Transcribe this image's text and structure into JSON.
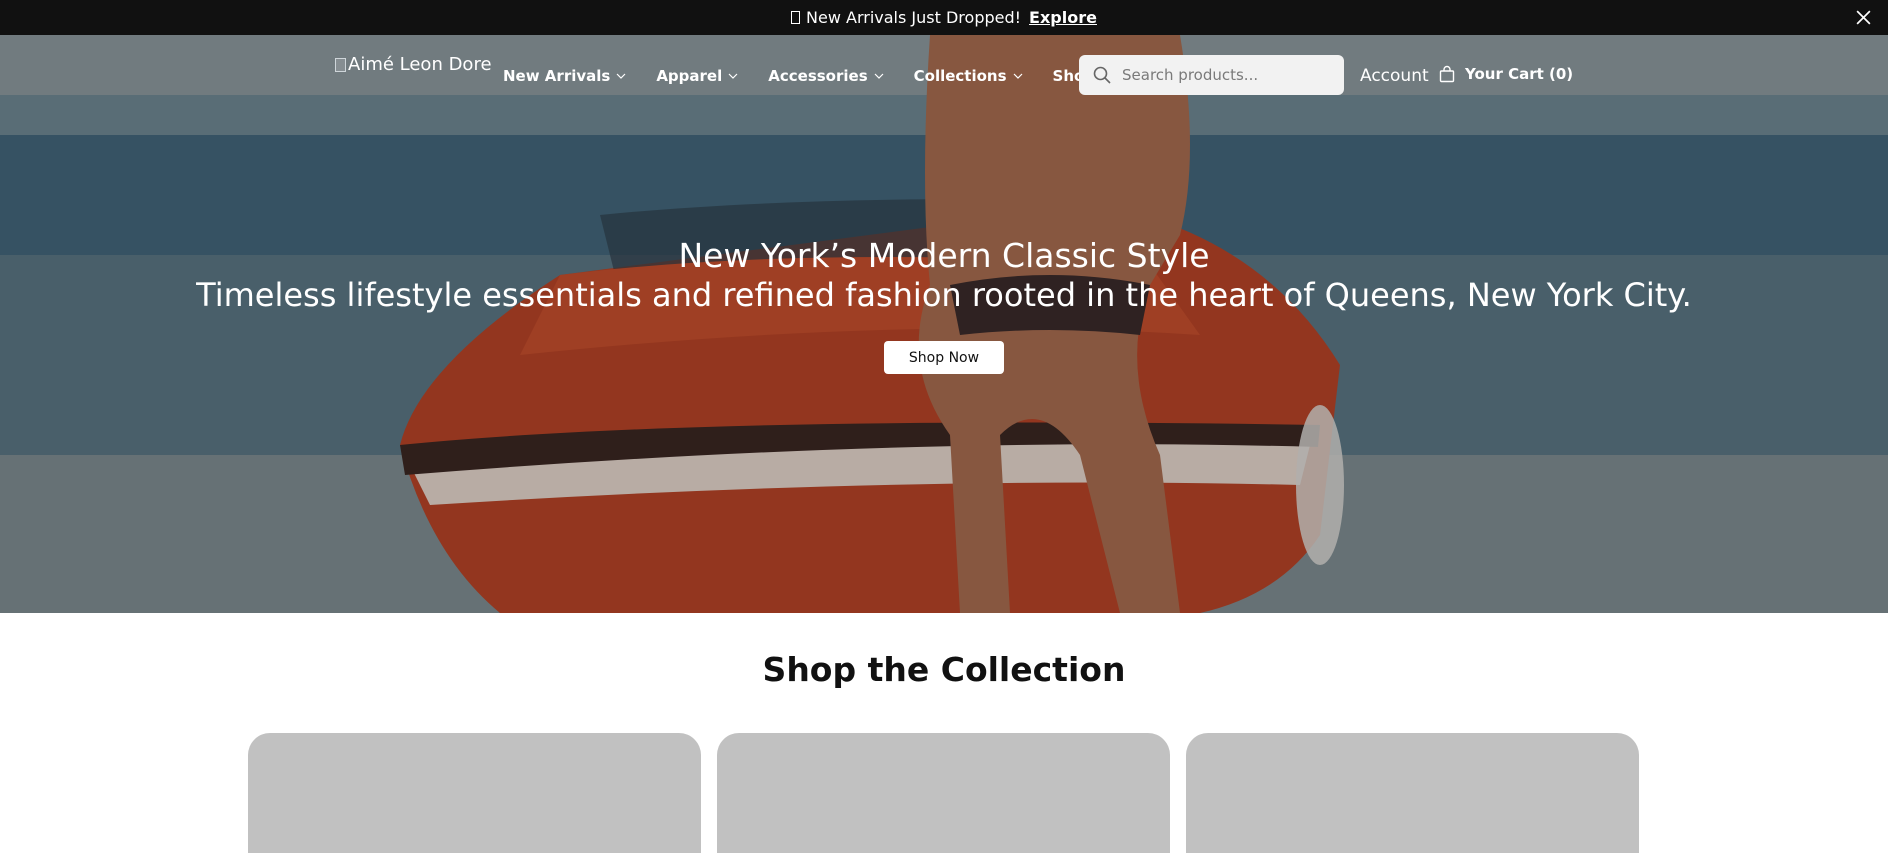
{
  "announcement": {
    "text": "New Arrivals Just Dropped!",
    "link_label": "Explore"
  },
  "header": {
    "logo_alt": "Aimé Leon Dore",
    "nav": [
      {
        "label": "New Arrivals"
      },
      {
        "label": "Apparel"
      },
      {
        "label": "Accessories"
      },
      {
        "label": "Collections"
      },
      {
        "label": "Shop All"
      }
    ],
    "search": {
      "placeholder": "Search products..."
    },
    "account_label": "Account",
    "cart_label": "Your Cart (0)"
  },
  "hero": {
    "title": "New York’s Modern Classic Style",
    "subtitle": "Timeless lifestyle essentials and refined fashion rooted in the heart of Queens, New York City.",
    "cta_label": "Shop Now"
  },
  "collection": {
    "title": "Shop the Collection",
    "cards": [
      {},
      {},
      {}
    ]
  },
  "colors": {
    "announce_bg": "#111111",
    "card_placeholder": "#c1c1c1",
    "text_dark": "#111111"
  }
}
